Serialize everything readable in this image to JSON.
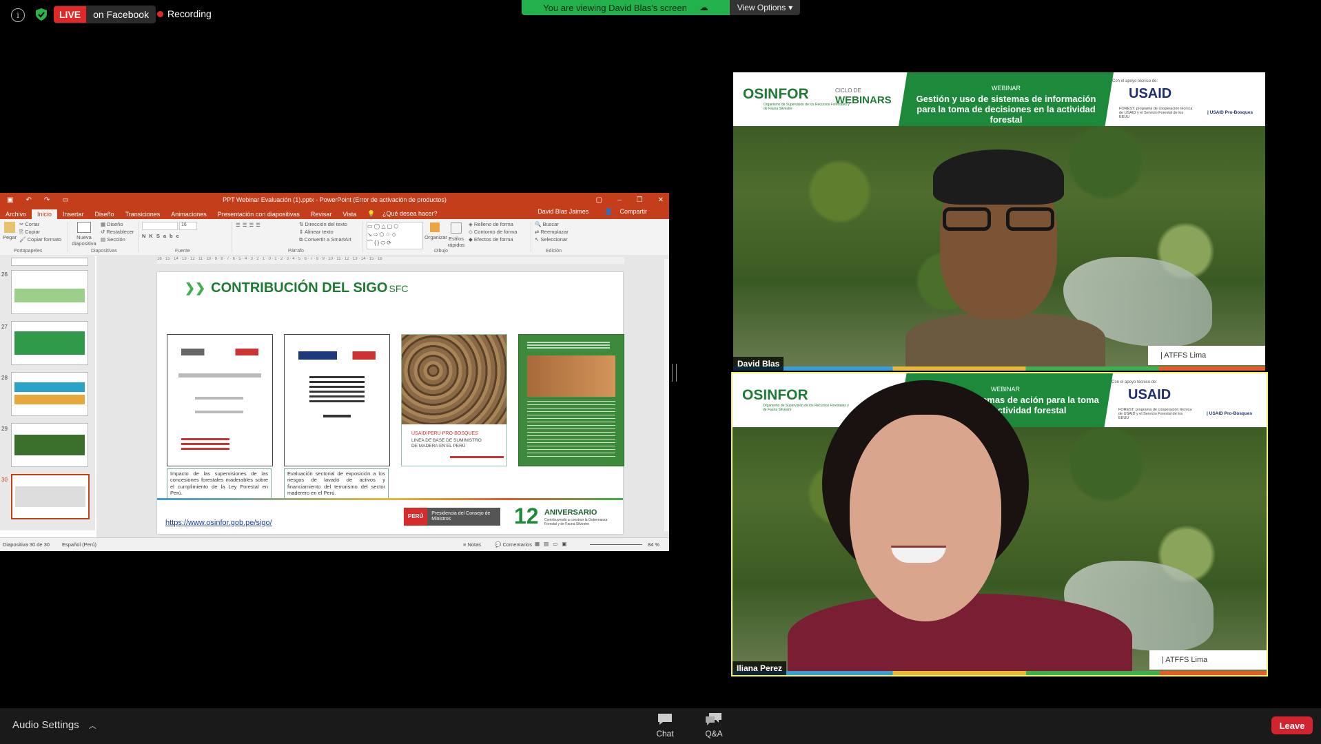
{
  "topbar": {
    "live_label": "LIVE",
    "live_platform": "on Facebook",
    "recording_label": "Recording",
    "viewing_banner": "You are viewing David Blas's screen",
    "view_options": "View Options"
  },
  "ppt": {
    "window_title": "PPT Webinar Evaluación (1).pptx - PowerPoint (Error de activación de productos)",
    "tabs": [
      "Archivo",
      "Inicio",
      "Insertar",
      "Diseño",
      "Transiciones",
      "Animaciones",
      "Presentación con diapositivas",
      "Revisar",
      "Vista"
    ],
    "tell_me": "¿Qué desea hacer?",
    "user": "David Blas Jaimes",
    "share": "Compartir",
    "ribbon": {
      "paste": "Pegar",
      "cut": "Cortar",
      "copy": "Copiar",
      "format_painter": "Copiar formato",
      "clipboard_group": "Portapapeles",
      "new_slide": "Nueva diapositiva",
      "layout": "Diseño",
      "reset": "Restablecer",
      "section": "Sección",
      "slides_group": "Diapositivas",
      "font_group": "Fuente",
      "font_size": "16",
      "text_direction": "Dirección del texto",
      "align_text": "Alinear texto",
      "smartart": "Convertir a SmartArt",
      "paragraph_group": "Párrafo",
      "arrange": "Organizar",
      "quick_styles": "Estilos rápidos",
      "shape_fill": "Relleno de forma",
      "shape_outline": "Contorno de forma",
      "shape_effects": "Efectos de forma",
      "drawing_group": "Dibujo",
      "find": "Buscar",
      "replace": "Reemplazar",
      "select": "Seleccionar",
      "editing_group": "Edición"
    },
    "thumbnails": [
      {
        "num": "26"
      },
      {
        "num": "27"
      },
      {
        "num": "28"
      },
      {
        "num": "29"
      },
      {
        "num": "30"
      }
    ],
    "slide": {
      "title": "CONTRIBUCIÓN DEL SIGO",
      "title_suffix": "SFC",
      "doc3_title": "USAID/PERU PRO-BOSQUES",
      "doc3_sub": "LINEA DE BASE DE SUMINISTRO DE MADERA EN EL PERÚ",
      "caption1": "Impacto de las supervisiones de las concesiones forestales maderables sobre el cumplimiento de la Ley Forestal en Perú.",
      "caption2": "Evaluación sectorial de exposición a los riesgos de lavado de activos y financiamiento del terrorismo del sector maderero en el Perú.",
      "link": "https://www.osinfor.gob.pe/sigo/",
      "peru": "PERÚ",
      "pcm": "Presidencia del Consejo de Ministros",
      "aniv_num": "12",
      "aniv": "ANIVERSARIO",
      "aniv_sub": "Contribuyendo a construir la Gobernanza Forestal y de Fauna Silvestre"
    },
    "status": {
      "slide_counter": "Diapositiva 30 de 30",
      "language": "Español (Perú)",
      "notes": "Notas",
      "comments": "Comentarios",
      "zoom": "84 %"
    }
  },
  "tiles": [
    {
      "name": "David Blas",
      "atffs": "| ATFFS Lima"
    },
    {
      "name": "Iliana Perez",
      "atffs": "| ATFFS Lima"
    }
  ],
  "banner": {
    "osinfor": "OSINFOR",
    "osinfor_sub": "Organismo de Supervisión de los Recursos Forestales y de Fauna Silvestre",
    "ciclo": "CICLO DE",
    "webinars": "WEBINARS",
    "webinar_label": "WEBINAR",
    "headline": "Gestión y uso de sistemas de información para la toma de decisiones en la actividad forestal",
    "headline_cropped": "ión y uso de sistemas de ación para la toma de es en la actividad forestal",
    "support": "Con el apoyo técnico de:",
    "usaid": "USAID",
    "forest_program": "FOREST: programa de cooperación técnica de USAID y el Servicio Forestal de los EEUU",
    "probosques": "| USAID Pro-Bosques"
  },
  "bottom": {
    "audio_settings": "Audio Settings",
    "chat": "Chat",
    "qa": "Q&A",
    "leave": "Leave"
  },
  "colors": {
    "ppt_red": "#c43e1c",
    "zoom_green": "#22b14c",
    "leave_red": "#d1242f",
    "osinfor_green": "#1f7a35",
    "active_speaker_border": "#f1f066"
  }
}
